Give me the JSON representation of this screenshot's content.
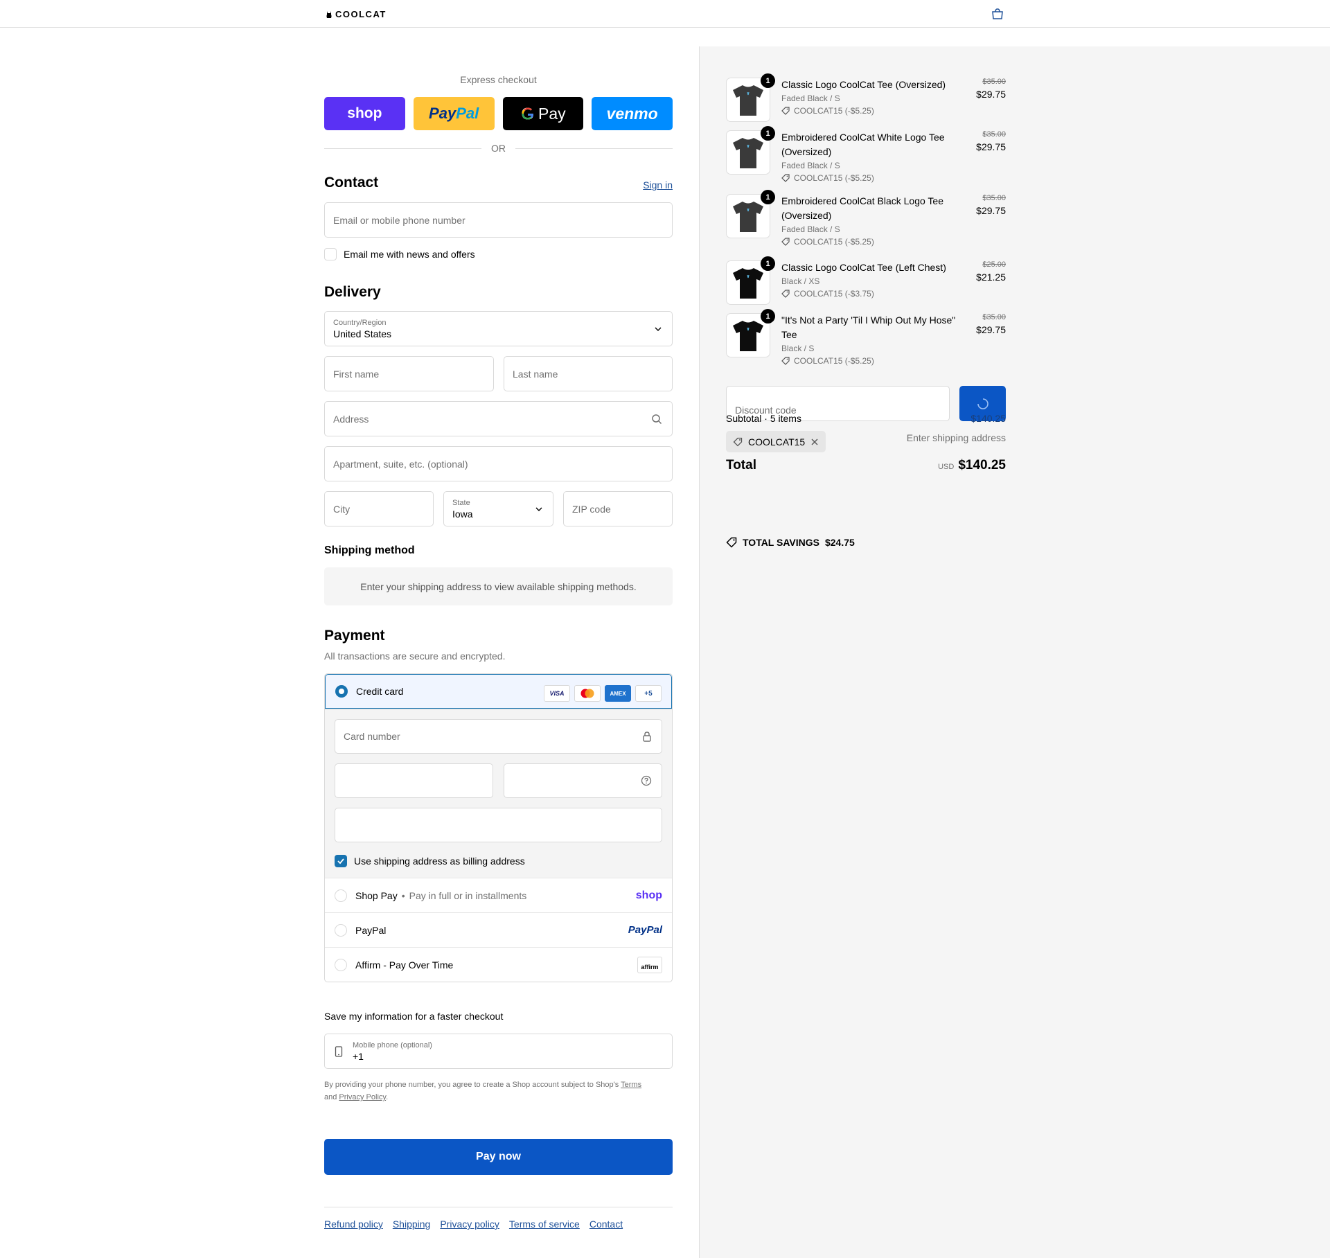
{
  "header": {
    "brand": "COOLCAT"
  },
  "express": {
    "title": "Express checkout",
    "shop_label": "shop",
    "paypal_label_a": "Pay",
    "paypal_label_b": "Pal",
    "gpay_label": "Pay",
    "venmo_label": "venmo",
    "or_label": "OR"
  },
  "contact": {
    "title": "Contact",
    "sign_in": "Sign in",
    "email_placeholder": "Email or mobile phone number",
    "news_label": "Email me with news and offers"
  },
  "delivery": {
    "title": "Delivery",
    "country_label": "Country/Region",
    "country_value": "United States",
    "first_name": "First name",
    "last_name": "Last name",
    "address": "Address",
    "apartment": "Apartment, suite, etc. (optional)",
    "city": "City",
    "state_label": "State",
    "state_value": "Iowa",
    "zip": "ZIP code"
  },
  "shipping": {
    "title": "Shipping method",
    "notice": "Enter your shipping address to view available shipping methods."
  },
  "payment": {
    "title": "Payment",
    "subtitle": "All transactions are secure and encrypted.",
    "credit_card": "Credit card",
    "card_brands": [
      "VISA",
      "MC",
      "AMEX",
      "+5"
    ],
    "card_number": "Card number",
    "billing_same": "Use shipping address as billing address",
    "shop_pay": "Shop Pay",
    "shop_pay_sub": "Pay in full or in installments",
    "shop_pay_logo": "shop",
    "paypal": "PayPal",
    "paypal_logo": "PayPal",
    "affirm": "Affirm - Pay Over Time",
    "affirm_logo": "affirm"
  },
  "save_info": {
    "title": "Save my information for a faster checkout",
    "phone_label": "Mobile phone (optional)",
    "phone_value": "+1",
    "legal_a": "By providing your phone number, you agree to create a Shop account subject to Shop's ",
    "legal_terms": "Terms",
    "legal_b": "and ",
    "legal_privacy": "Privacy Policy",
    "legal_c": "."
  },
  "pay_now": "Pay now",
  "footer": [
    "Refund policy",
    "Shipping",
    "Privacy policy",
    "Terms of service",
    "Contact"
  ],
  "cart": {
    "items": [
      {
        "qty": "1",
        "name": "Classic Logo CoolCat Tee (Oversized)",
        "variant": "Faded Black / S",
        "discount": "COOLCAT15 (-$5.25)",
        "old_price": "$35.00",
        "price": "$29.75",
        "shirt_color": "#3a3a3a"
      },
      {
        "qty": "1",
        "name": "Embroidered CoolCat White Logo Tee (Oversized)",
        "variant": "Faded Black / S",
        "discount": "COOLCAT15 (-$5.25)",
        "old_price": "$35.00",
        "price": "$29.75",
        "shirt_color": "#3a3a3a"
      },
      {
        "qty": "1",
        "name": "Embroidered CoolCat Black Logo Tee (Oversized)",
        "variant": "Faded Black / S",
        "discount": "COOLCAT15 (-$5.25)",
        "old_price": "$35.00",
        "price": "$29.75",
        "shirt_color": "#3a3a3a"
      },
      {
        "qty": "1",
        "name": "Classic Logo CoolCat Tee (Left Chest)",
        "variant": "Black / XS",
        "discount": "COOLCAT15 (-$3.75)",
        "old_price": "$25.00",
        "price": "$21.25",
        "shirt_color": "#0d0d0d"
      },
      {
        "qty": "1",
        "name": "\"It's Not a Party 'Til I Whip Out My Hose\" Tee",
        "variant": "Black / S",
        "discount": "COOLCAT15 (-$5.25)",
        "old_price": "$35.00",
        "price": "$29.75",
        "shirt_color": "#0d0d0d"
      }
    ],
    "discount_placeholder": "Discount code",
    "subtotal_label": "Subtotal · 5 items",
    "subtotal_value": "$140.25",
    "applied_code": "COOLCAT15",
    "shipping_right": "Enter shipping address",
    "total_label": "Total",
    "currency": "USD",
    "total_value": "$140.25",
    "savings_label": "TOTAL SAVINGS",
    "savings_value": "$24.75"
  },
  "colors": {
    "accent": "#0b56c5",
    "link": "#1f5199",
    "shop_purple": "#5a31f4"
  }
}
